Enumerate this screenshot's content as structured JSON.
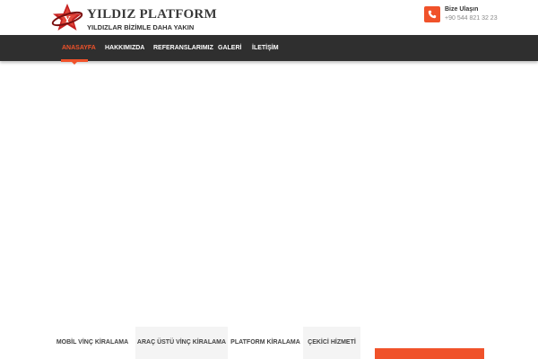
{
  "brand": {
    "title": "YILDIZ PLATFORM",
    "slogan": "YILDIZLAR BİZİMLE DAHA YAKIN",
    "logo_icon": "star-logo-icon",
    "accent_color": "#f0522a",
    "logo_color": "#b31b1b"
  },
  "contact": {
    "icon": "phone-icon",
    "title": "Bize Ulaşın",
    "phone": "+90 544 821 32 23"
  },
  "nav": {
    "items": [
      {
        "label": "ANASAYFA",
        "active": true
      },
      {
        "label": "HAKKIMIZDA",
        "active": false
      },
      {
        "label": "REFERANSLARIMIZ",
        "active": false
      },
      {
        "label": "GALERİ",
        "active": false
      },
      {
        "label": "İLETİŞİM",
        "active": false
      }
    ],
    "background": "#2f2f2f"
  },
  "service_tabs": [
    {
      "label": "MOBİL VİNÇ KİRALAMA"
    },
    {
      "label": "ARAÇ ÜSTÜ VİNÇ KİRALAMA"
    },
    {
      "label": "PLATFORM KİRALAMA"
    },
    {
      "label": "ÇEKİCİ HİZMETİ"
    }
  ]
}
